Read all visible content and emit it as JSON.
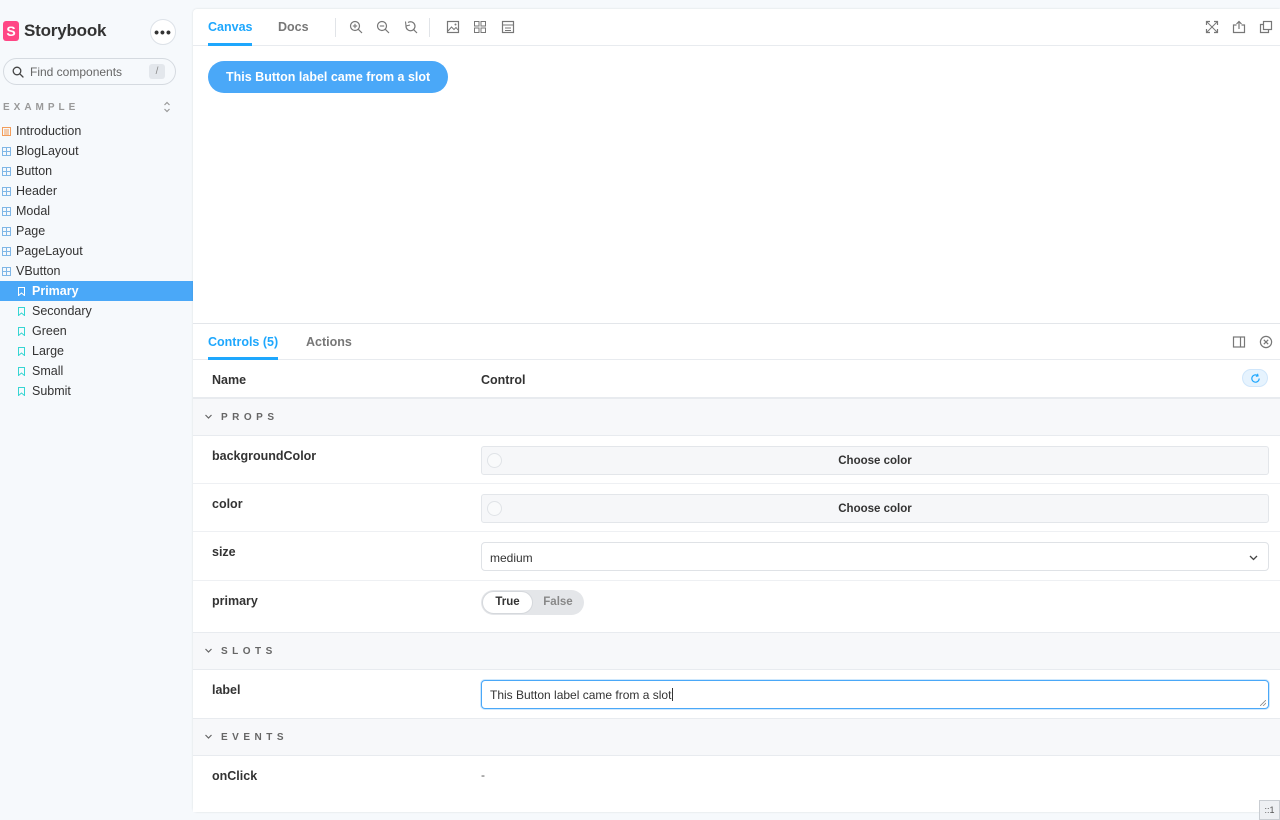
{
  "sidebar": {
    "brand": {
      "logo_letter": "S",
      "name": "Storybook"
    },
    "more_label": "•••",
    "search": {
      "placeholder": "Find components",
      "shortcut": "/"
    },
    "group": {
      "label": "EXAMPLE",
      "toggle": "⌃⌄"
    },
    "components": [
      {
        "label": "Introduction",
        "icon": "document-icon"
      },
      {
        "label": "BlogLayout",
        "icon": "component-icon"
      },
      {
        "label": "Button",
        "icon": "component-icon"
      },
      {
        "label": "Header",
        "icon": "component-icon"
      },
      {
        "label": "Modal",
        "icon": "component-icon"
      },
      {
        "label": "Page",
        "icon": "component-icon"
      },
      {
        "label": "PageLayout",
        "icon": "component-icon"
      },
      {
        "label": "VButton",
        "icon": "component-icon"
      }
    ],
    "stories": [
      {
        "label": "Primary",
        "selected": true
      },
      {
        "label": "Secondary",
        "selected": false
      },
      {
        "label": "Green",
        "selected": false
      },
      {
        "label": "Large",
        "selected": false
      },
      {
        "label": "Small",
        "selected": false
      },
      {
        "label": "Submit",
        "selected": false
      }
    ]
  },
  "toolbar": {
    "tabs": [
      {
        "label": "Canvas",
        "active": true
      },
      {
        "label": "Docs",
        "active": false
      }
    ],
    "tools": [
      "zoom-in-icon",
      "zoom-out-icon",
      "zoom-reset-icon",
      "background-image-icon",
      "grid-icon",
      "outline-icon"
    ],
    "right_tools": [
      "fullscreen-icon",
      "share-icon",
      "copy-icon"
    ]
  },
  "preview": {
    "button_label": "This Button label came from a slot"
  },
  "addons": {
    "tabs": [
      {
        "label": "Controls (5)",
        "active": true
      },
      {
        "label": "Actions",
        "active": false
      }
    ],
    "right_icons": [
      "panel-layout-icon",
      "close-circle-icon"
    ],
    "table": {
      "name_header": "Name",
      "control_header": "Control",
      "reset_icon": "reset-icon"
    },
    "sections": {
      "props": "PROPS",
      "slots": "SLOTS",
      "events": "EVENTS"
    },
    "props": {
      "backgroundColor": {
        "name": "backgroundColor",
        "control_label": "Choose color"
      },
      "color": {
        "name": "color",
        "control_label": "Choose color"
      },
      "size": {
        "name": "size",
        "value": "medium"
      },
      "primary": {
        "name": "primary",
        "true_label": "True",
        "false_label": "False",
        "value": true
      }
    },
    "slots": {
      "label": {
        "name": "label",
        "value": "This Button label came from a slot"
      }
    },
    "events": {
      "onClick": {
        "name": "onClick",
        "value": "-"
      }
    }
  },
  "corner_badge": "::1",
  "colors": {
    "accent": "#1ea7fd",
    "selected": "#4aa8f8",
    "brand": "#ff4785",
    "document_icon": "#f39d5a",
    "component_icon": "#7fb6e6",
    "story_icon": "#37d5d3"
  }
}
